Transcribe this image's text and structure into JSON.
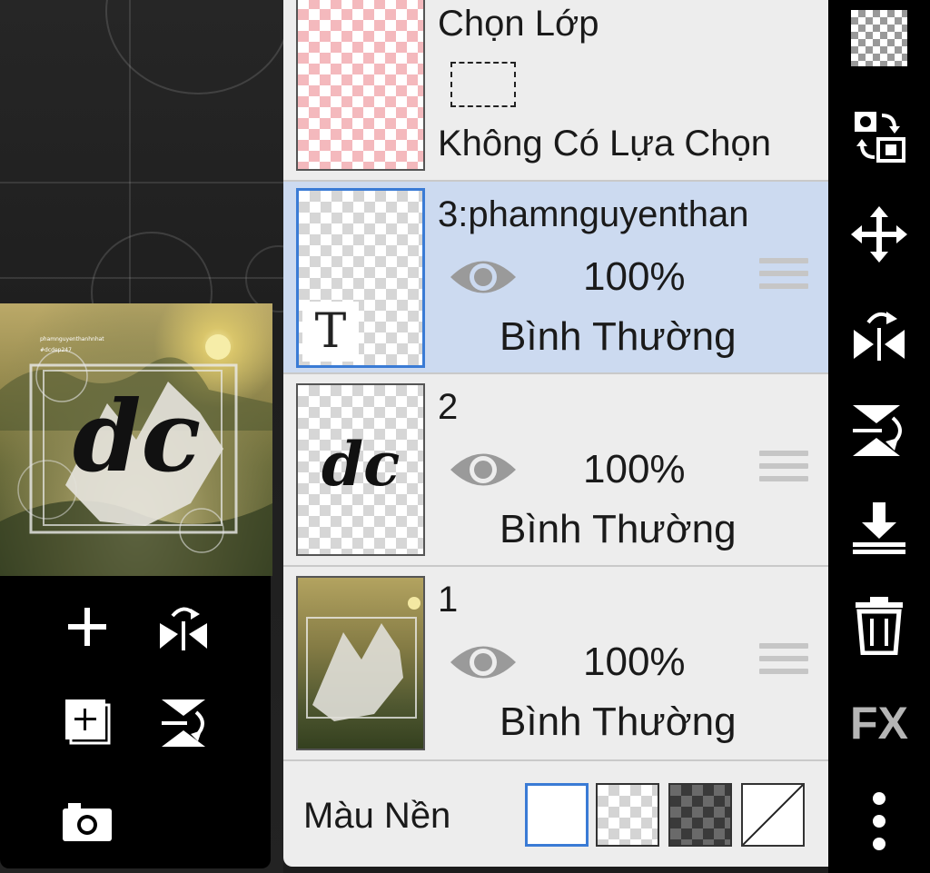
{
  "selection": {
    "title": "Chọn Lớp",
    "status": "Không Có Lựa Chọn"
  },
  "layers": [
    {
      "name": "3:phamnguyenthan",
      "opacity": "100%",
      "blend": "Bình Thường",
      "type": "text",
      "type_badge": "T",
      "selected": true,
      "visible": true
    },
    {
      "name": "2",
      "opacity": "100%",
      "blend": "Bình Thường",
      "type": "raster",
      "thumb_text": "dc",
      "selected": false,
      "visible": true
    },
    {
      "name": "1",
      "opacity": "100%",
      "blend": "Bình Thường",
      "type": "image",
      "selected": false,
      "visible": true
    }
  ],
  "background": {
    "label": "Màu Nền",
    "options": [
      "white",
      "transparent-light",
      "transparent-dark",
      "none"
    ],
    "selected": "white"
  },
  "preview": {
    "art_text": "dc",
    "watermark_line1": "phamnguyenthanhnhat",
    "watermark_line2": "#dcdep247"
  },
  "right_toolbar": {
    "items": [
      "transparency-icon",
      "swap-layers-icon",
      "move-icon",
      "flip-horizontal-icon",
      "flip-vertical-icon",
      "merge-down-icon",
      "delete-icon",
      "fx-icon",
      "more-icon"
    ],
    "fx_label": "FX"
  },
  "left_toolbar": {
    "items": [
      "add-layer-icon",
      "flip-horizontal-icon",
      "duplicate-layer-icon",
      "flip-vertical-icon",
      "camera-icon"
    ]
  },
  "colors": {
    "accent": "#3a7bd5",
    "selected_row": "#ccdaf0",
    "panel": "#ededed",
    "toolbar": "#000000"
  }
}
